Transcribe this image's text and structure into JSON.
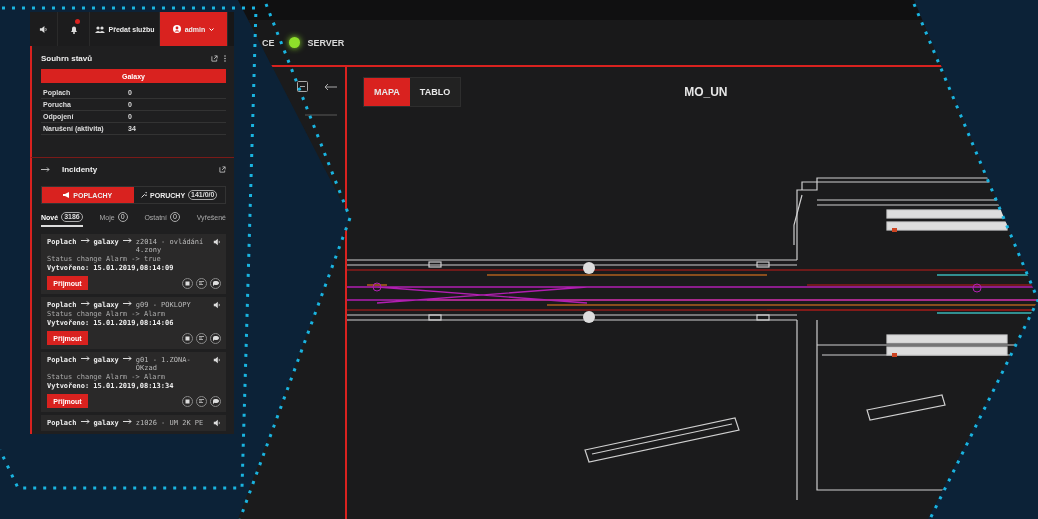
{
  "main_window": {
    "header": {
      "cut_label": "CE",
      "server_status": {
        "label": "SERVER",
        "online": true
      }
    },
    "view_tabs": [
      {
        "label": "MAPA",
        "selected": true
      },
      {
        "label": "TABLO",
        "selected": false
      }
    ],
    "map_title": "MO_UN"
  },
  "side_panel": {
    "toolbar": {
      "notification_alert": true,
      "handover_label": "Předat službu",
      "user": "admin"
    },
    "summary": {
      "title": "Souhrn stavů",
      "system_button": "Galaxy",
      "rows": [
        {
          "label": "Poplach",
          "value": "0"
        },
        {
          "label": "Porucha",
          "value": "0"
        },
        {
          "label": "Odpojení",
          "value": "0"
        },
        {
          "label": "Narušení (aktivita)",
          "value": "34"
        }
      ]
    },
    "incidents": {
      "title": "Incidenty",
      "type_tabs": [
        {
          "label": "POPLACHY",
          "selected": true
        },
        {
          "label": "PORUCHY",
          "count": "141/0/0",
          "selected": false
        }
      ],
      "filter_tabs": [
        {
          "label": "Nové",
          "count": "3186",
          "selected": true
        },
        {
          "label": "Moje",
          "count": "0",
          "selected": false
        },
        {
          "label": "Ostatní",
          "count": "0",
          "selected": false
        },
        {
          "label": "Vyřešené",
          "selected": false
        }
      ],
      "cards": [
        {
          "category": "Poplach",
          "system": "galaxy",
          "zone": "z2014 - ovládání 4.zony",
          "status": "Status change Alarm -> true",
          "created": "Vytvořeno: 15.01.2019,08:14:09",
          "action": "Přijmout"
        },
        {
          "category": "Poplach",
          "system": "galaxy",
          "zone": "g09 - POKLOPY",
          "status": "Status change Alarm -> Alarm",
          "created": "Vytvořeno: 15.01.2019,08:14:06",
          "action": "Přijmout"
        },
        {
          "category": "Poplach",
          "system": "galaxy",
          "zone": "g01 - 1.ZONA-OKzad",
          "status": "Status change Alarm -> Alarm",
          "created": "Vytvořeno: 15.01.2019,08:13:34",
          "action": "Přijmout"
        },
        {
          "category": "Poplach",
          "system": "galaxy",
          "zone": "z1026 - UM 2K PE"
        }
      ]
    }
  }
}
